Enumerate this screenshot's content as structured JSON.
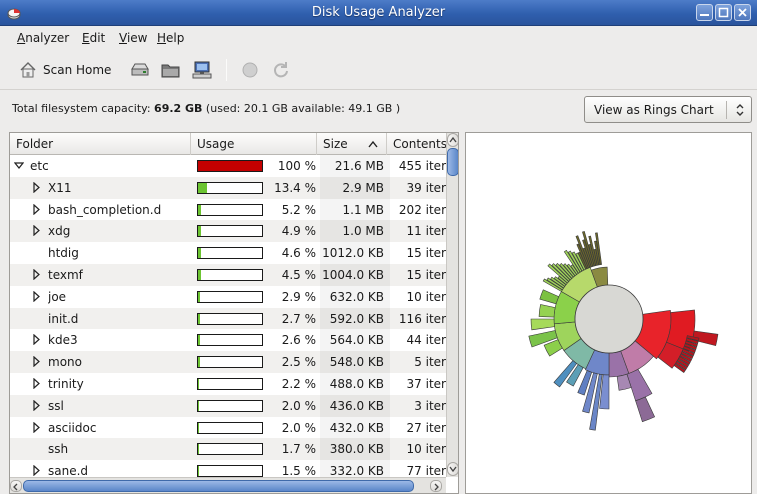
{
  "window": {
    "title": "Disk Usage Analyzer"
  },
  "menubar": {
    "items": [
      {
        "label": "Analyzer",
        "accel_index": 0
      },
      {
        "label": "Edit",
        "accel_index": 0
      },
      {
        "label": "View",
        "accel_index": 0
      },
      {
        "label": "Help",
        "accel_index": 0
      }
    ]
  },
  "toolbar": {
    "scan_home_label": "Scan Home",
    "icons": [
      "home-icon",
      "scan-filesystem-icon",
      "scan-folder-icon",
      "scan-remote-icon",
      "stop-icon",
      "refresh-icon"
    ]
  },
  "info": {
    "capacity_prefix": "Total filesystem capacity: ",
    "capacity_value": "69.2 GB",
    "capacity_suffix": " (used: 20.1 GB available: 49.1 GB )"
  },
  "view_select": {
    "selected": "View as Rings Chart"
  },
  "tree": {
    "columns": [
      "Folder",
      "Usage",
      "Size",
      "Contents"
    ],
    "sort_indicator": "^",
    "rows": [
      {
        "name": "etc",
        "expander": "expanded",
        "level": 0,
        "usage_pct": 100,
        "usage_text": "100 %",
        "size": "21.6 MB",
        "contents": "455 iter",
        "bar_color": "#c40000"
      },
      {
        "name": "X11",
        "expander": "collapsed",
        "level": 1,
        "usage_pct": 13.4,
        "usage_text": "13.4 %",
        "size": "2.9 MB",
        "contents": "39 iter",
        "bar_color": "#6cc431"
      },
      {
        "name": "bash_completion.d",
        "expander": "collapsed",
        "level": 1,
        "usage_pct": 5.2,
        "usage_text": "5.2 %",
        "size": "1.1 MB",
        "contents": "202 iter",
        "bar_color": "#6cc431"
      },
      {
        "name": "xdg",
        "expander": "collapsed",
        "level": 1,
        "usage_pct": 4.9,
        "usage_text": "4.9 %",
        "size": "1.0 MB",
        "contents": "11 iter",
        "bar_color": "#6cc431"
      },
      {
        "name": "htdig",
        "expander": "none",
        "level": 1,
        "usage_pct": 4.6,
        "usage_text": "4.6 %",
        "size": "1012.0 KB",
        "contents": "15 iter",
        "bar_color": "#6cc431"
      },
      {
        "name": "texmf",
        "expander": "collapsed",
        "level": 1,
        "usage_pct": 4.5,
        "usage_text": "4.5 %",
        "size": "1004.0 KB",
        "contents": "15 iter",
        "bar_color": "#6cc431"
      },
      {
        "name": "joe",
        "expander": "collapsed",
        "level": 1,
        "usage_pct": 2.9,
        "usage_text": "2.9 %",
        "size": "632.0 KB",
        "contents": "10 iter",
        "bar_color": "#6cc431"
      },
      {
        "name": "init.d",
        "expander": "none",
        "level": 1,
        "usage_pct": 2.7,
        "usage_text": "2.7 %",
        "size": "592.0 KB",
        "contents": "116 iter",
        "bar_color": "#6cc431"
      },
      {
        "name": "kde3",
        "expander": "collapsed",
        "level": 1,
        "usage_pct": 2.6,
        "usage_text": "2.6 %",
        "size": "564.0 KB",
        "contents": "44 iter",
        "bar_color": "#6cc431"
      },
      {
        "name": "mono",
        "expander": "collapsed",
        "level": 1,
        "usage_pct": 2.5,
        "usage_text": "2.5 %",
        "size": "548.0 KB",
        "contents": "5 iter",
        "bar_color": "#6cc431"
      },
      {
        "name": "trinity",
        "expander": "collapsed",
        "level": 1,
        "usage_pct": 2.2,
        "usage_text": "2.2 %",
        "size": "488.0 KB",
        "contents": "37 iter",
        "bar_color": "#6cc431"
      },
      {
        "name": "ssl",
        "expander": "collapsed",
        "level": 1,
        "usage_pct": 2.0,
        "usage_text": "2.0 %",
        "size": "436.0 KB",
        "contents": "3 iter",
        "bar_color": "#6cc431"
      },
      {
        "name": "asciidoc",
        "expander": "collapsed",
        "level": 1,
        "usage_pct": 2.0,
        "usage_text": "2.0 %",
        "size": "432.0 KB",
        "contents": "27 iter",
        "bar_color": "#6cc431"
      },
      {
        "name": "ssh",
        "expander": "none",
        "level": 1,
        "usage_pct": 1.7,
        "usage_text": "1.7 %",
        "size": "380.0 KB",
        "contents": "10 iter",
        "bar_color": "#6cc431"
      },
      {
        "name": "sane.d",
        "expander": "collapsed",
        "level": 1,
        "usage_pct": 1.5,
        "usage_text": "1.5 %",
        "size": "332.0 KB",
        "contents": "77 iter",
        "bar_color": "#6cc431"
      }
    ]
  },
  "rings_chart": {
    "center_color": "#d8d8d4",
    "segment_colors": {
      "red": "#e8232a",
      "green": "#8bd14a",
      "blue": "#6f87c9",
      "purple": "#9a72a8",
      "pink": "#c07ca8"
    }
  }
}
